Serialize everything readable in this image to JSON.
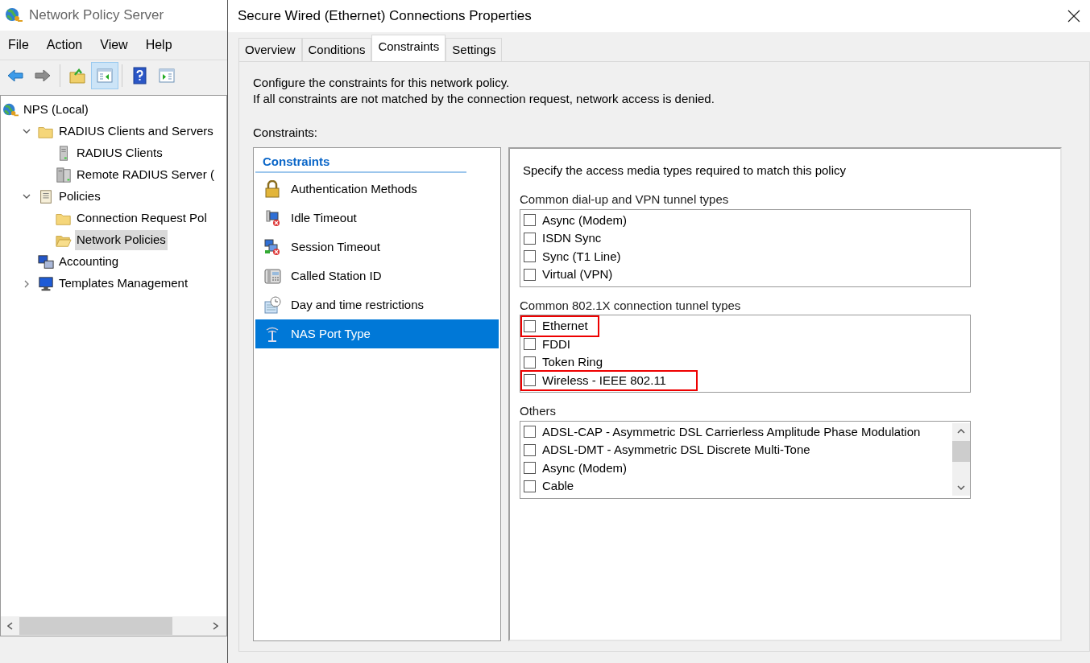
{
  "app": {
    "title": "Network Policy Server",
    "menu": [
      "File",
      "Action",
      "View",
      "Help"
    ],
    "toolbar": [
      {
        "kind": "back",
        "pressed": false
      },
      {
        "kind": "forward",
        "pressed": false
      },
      {
        "kind": "up",
        "pressed": false
      },
      {
        "kind": "tree",
        "pressed": true
      },
      {
        "kind": "help",
        "pressed": false
      },
      {
        "kind": "pane",
        "pressed": false
      }
    ],
    "tree": [
      {
        "label": "NPS (Local)",
        "kind": "globe",
        "selected": false,
        "children": [
          {
            "label": "RADIUS Clients and Servers",
            "kind": "folder",
            "expanded": true,
            "selected": false,
            "children": [
              {
                "label": "RADIUS Clients",
                "kind": "server",
                "selected": false
              },
              {
                "label": "Remote RADIUS Server (",
                "kind": "servers",
                "selected": false
              }
            ]
          },
          {
            "label": "Policies",
            "kind": "scroll",
            "expanded": true,
            "selected": false,
            "children": [
              {
                "label": "Connection Request Pol",
                "kind": "folder",
                "selected": false
              },
              {
                "label": "Network Policies",
                "kind": "folder-open",
                "selected": true
              }
            ]
          },
          {
            "label": "Accounting",
            "kind": "computers",
            "selected": false
          },
          {
            "label": "Templates Management",
            "kind": "monitor",
            "expanded": false,
            "selected": false
          }
        ]
      }
    ]
  },
  "dialog": {
    "title": "Secure Wired (Ethernet) Connections Properties",
    "tabs": [
      {
        "label": "Overview",
        "selected": false
      },
      {
        "label": "Conditions",
        "selected": false
      },
      {
        "label": "Constraints",
        "selected": true
      },
      {
        "label": "Settings",
        "selected": false
      }
    ],
    "description": [
      "Configure the constraints for this network policy.",
      "If all constraints are not matched by the connection request, network access is denied."
    ],
    "constraints_label": "Constraints:",
    "constraint_list": {
      "heading": "Constraints",
      "items": [
        {
          "label": "Authentication Methods",
          "kind": "lock",
          "selected": false
        },
        {
          "label": "Idle Timeout",
          "kind": "computer-x",
          "selected": false
        },
        {
          "label": "Session Timeout",
          "kind": "computers-x",
          "selected": false
        },
        {
          "label": "Called Station ID",
          "kind": "phone",
          "selected": false
        },
        {
          "label": "Day and time restrictions",
          "kind": "calendar",
          "selected": false
        },
        {
          "label": "NAS Port Type",
          "kind": "antenna",
          "selected": true
        }
      ]
    },
    "nas_panel": {
      "instruction": "Specify the access media types required to match this policy",
      "groups": [
        {
          "title": "Common dial-up and VPN tunnel types",
          "kind": "list",
          "items": [
            {
              "label": "Async (Modem)",
              "checked": false,
              "highlighted": false
            },
            {
              "label": "ISDN Sync",
              "checked": false,
              "highlighted": false
            },
            {
              "label": "Sync (T1 Line)",
              "checked": false,
              "highlighted": false
            },
            {
              "label": "Virtual (VPN)",
              "checked": false,
              "highlighted": false
            }
          ]
        },
        {
          "title": "Common 802.1X connection tunnel types",
          "kind": "list",
          "items": [
            {
              "label": "Ethernet",
              "checked": false,
              "highlighted": true
            },
            {
              "label": "FDDI",
              "checked": false,
              "highlighted": false
            },
            {
              "label": "Token Ring",
              "checked": false,
              "highlighted": false
            },
            {
              "label": "Wireless - IEEE 802.11",
              "checked": false,
              "highlighted": true
            }
          ]
        },
        {
          "title": "Others",
          "kind": "scroll-list",
          "items": [
            {
              "label": "ADSL-CAP - Asymmetric DSL Carrierless Amplitude Phase Modulation",
              "checked": false,
              "highlighted": false
            },
            {
              "label": "ADSL-DMT - Asymmetric DSL Discrete Multi-Tone",
              "checked": false,
              "highlighted": false
            },
            {
              "label": "Async (Modem)",
              "checked": false,
              "highlighted": false
            },
            {
              "label": "Cable",
              "checked": false,
              "highlighted": false
            }
          ]
        }
      ]
    }
  }
}
